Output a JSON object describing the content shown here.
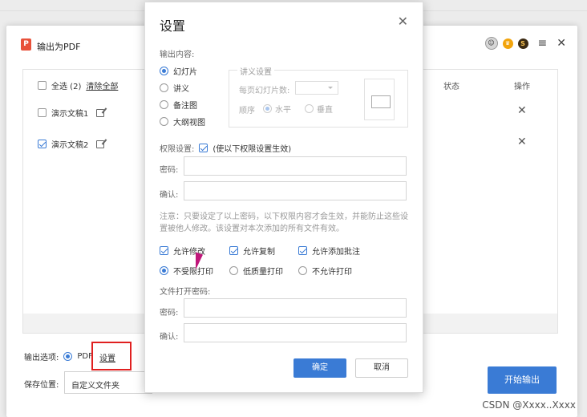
{
  "main": {
    "title": "输出为PDF",
    "select_all": "全选 (2)",
    "clear_all": "清除全部",
    "col_status": "状态",
    "col_action": "操作",
    "files": [
      {
        "name": "演示文稿1",
        "checked": false
      },
      {
        "name": "演示文稿2",
        "checked": true
      }
    ],
    "output_option_label": "输出选项:",
    "output_pdf": "PDF",
    "settings_link": "设置",
    "save_location_label": "保存位置:",
    "save_location_value": "自定义文件夹",
    "start_button": "开始输出"
  },
  "dialog": {
    "title": "设置",
    "output_content_label": "输出内容:",
    "content_options": [
      "幻灯片",
      "讲义",
      "备注图",
      "大纲视图"
    ],
    "handout_legend": "讲义设置",
    "slides_per_page": "每页幻灯片数:",
    "order_label": "顺序",
    "order_horizontal": "水平",
    "order_vertical": "垂直",
    "permission_label": "权限设置:",
    "permission_hint": "(使以下权限设置生效)",
    "password_label": "密码:",
    "confirm_label": "确认:",
    "note": "注意：只要设定了以上密码，以下权限内容才会生效，并能防止这些设置被他人修改。该设置对本次添加的所有文件有效。",
    "allow_modify": "允许修改",
    "allow_copy": "允许复制",
    "allow_annotate": "允许添加批注",
    "print_unrestricted": "不受限打印",
    "print_low_quality": "低质量打印",
    "print_disallow": "不允许打印",
    "open_password_label": "文件打开密码:",
    "open_password": "密码:",
    "open_confirm": "确认:",
    "ok_button": "确定",
    "cancel_button": "取消"
  },
  "watermark": "CSDN @Xxxx..Xxxx"
}
